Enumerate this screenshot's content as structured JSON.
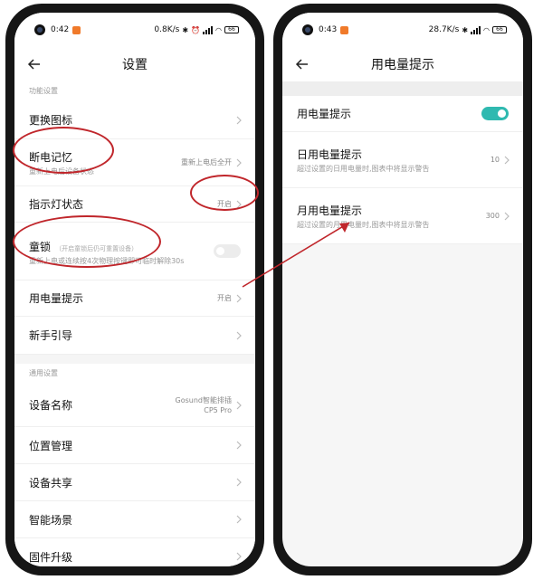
{
  "left_phone": {
    "status": {
      "time": "0:42",
      "speed": "0.8K/s",
      "battery": "66"
    },
    "nav": {
      "title": "设置"
    },
    "sections": [
      {
        "label": "功能设置",
        "rows": [
          {
            "title": "更换图标"
          },
          {
            "title": "断电记忆",
            "desc": "重新上电后设备状态",
            "value": "重新上电后全开"
          },
          {
            "title": "指示灯状态",
            "value": "开启"
          },
          {
            "title": "童锁",
            "hint": "（开启童锁后仍可重置设备）",
            "desc": "重新上电或连续按4次物理按键即可临时解除30s",
            "toggle": false
          },
          {
            "title": "用电量提示",
            "value": "开启"
          },
          {
            "title": "新手引导"
          }
        ]
      },
      {
        "label": "通用设置",
        "rows": [
          {
            "title": "设备名称",
            "value": "Gosund智能排插CP5 Pro"
          },
          {
            "title": "位置管理"
          },
          {
            "title": "设备共享"
          },
          {
            "title": "智能场景"
          },
          {
            "title": "固件升级"
          }
        ]
      }
    ]
  },
  "right_phone": {
    "status": {
      "time": "0:43",
      "speed": "28.7K/s",
      "battery": "66"
    },
    "nav": {
      "title": "用电量提示"
    },
    "rows": [
      {
        "title": "用电量提示",
        "toggle": true
      },
      {
        "title": "日用电量提示",
        "desc": "超过设置的日用电量时,图表中将显示警告",
        "value": "10"
      },
      {
        "title": "月用电量提示",
        "desc": "超过设置的月用电量时,图表中将显示警告",
        "value": "300"
      }
    ]
  },
  "colors": {
    "accent": "#2fb9b0",
    "annotation": "#c0262b",
    "app_badge": "#f07a2a"
  },
  "icons": [
    "back-arrow-icon",
    "chevron-right-icon",
    "bluetooth-icon",
    "signal-icon",
    "wifi-icon",
    "battery-icon",
    "alarm-icon"
  ]
}
